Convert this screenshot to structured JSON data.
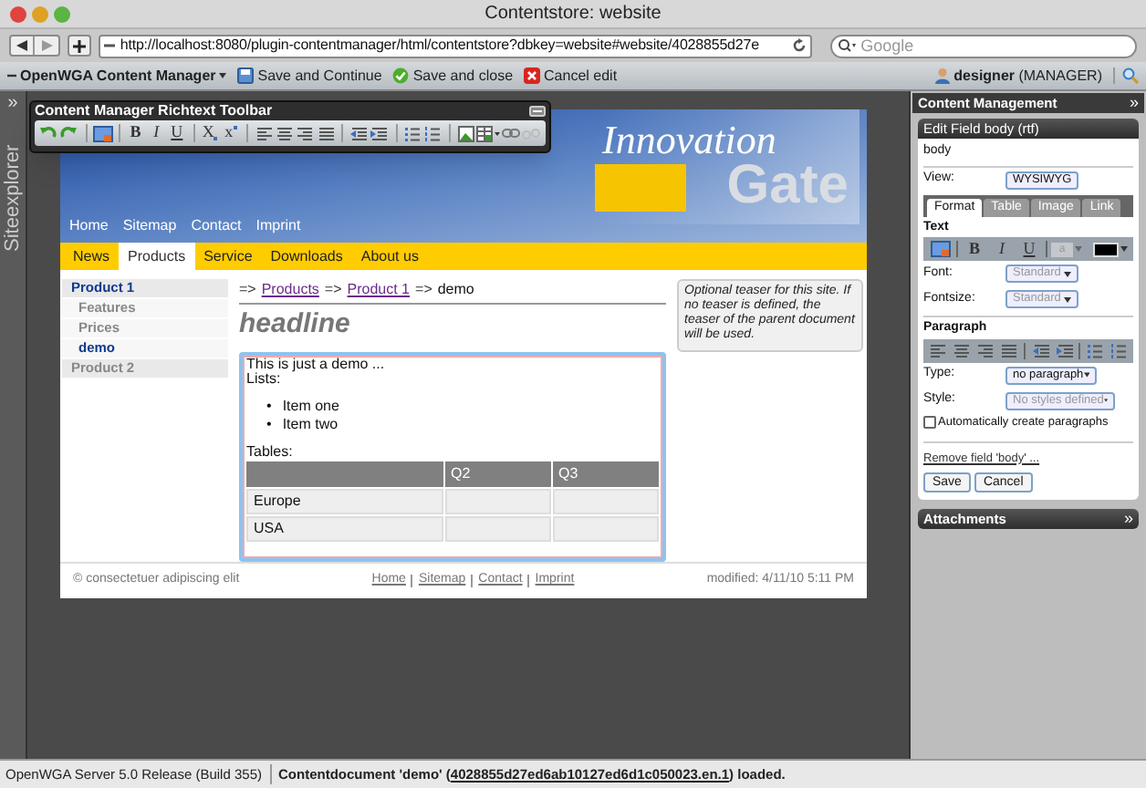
{
  "window": {
    "title": "Contentstore: website"
  },
  "browser_toolbar": {
    "url": "http://localhost:8080/plugin-contentmanager/html/contentstore?dbkey=website#website/4028855d27e",
    "search": {
      "placeholder": "Google"
    }
  },
  "cm_bar": {
    "menu": "OpenWGA Content Manager",
    "actions": [
      {
        "kind": "save",
        "label": "Save and Continue"
      },
      {
        "kind": "confirm",
        "label": "Save and close"
      },
      {
        "kind": "cancel",
        "label": "Cancel edit"
      }
    ],
    "user": "designer",
    "role": "(MANAGER)"
  },
  "siteexplorer": {
    "expand": "»",
    "label": "Siteexplorer"
  },
  "richtext_toolbar": {
    "title": "Content Manager Richtext Toolbar",
    "groups": [
      [
        {
          "kind": "undo"
        },
        {
          "kind": "redo"
        }
      ],
      [
        {
          "kind": "image"
        }
      ],
      [
        {
          "kind": "bold",
          "label": "B"
        },
        {
          "kind": "italic",
          "label": "I"
        },
        {
          "kind": "underline",
          "label": "U"
        }
      ],
      [
        {
          "kind": "subscript",
          "label": "X"
        },
        {
          "kind": "superscript",
          "label": "x"
        }
      ],
      [
        {
          "kind": "align-left"
        },
        {
          "kind": "align-center"
        },
        {
          "kind": "align-right"
        },
        {
          "kind": "justify"
        }
      ],
      [
        {
          "kind": "outdent"
        },
        {
          "kind": "indent"
        }
      ],
      [
        {
          "kind": "bullets"
        },
        {
          "kind": "numbers"
        }
      ],
      [
        {
          "kind": "picture"
        },
        {
          "kind": "table"
        },
        {
          "kind": "link"
        },
        {
          "kind": "unlink"
        }
      ]
    ]
  },
  "site": {
    "logo": {
      "line1": "Innovation",
      "line2": "Gate"
    },
    "top_links": [
      "Home",
      "Sitemap",
      "Contact",
      "Imprint"
    ],
    "nav": [
      {
        "label": "News",
        "selected": false
      },
      {
        "label": "Products",
        "selected": true
      },
      {
        "label": "Service",
        "selected": false
      },
      {
        "label": "Downloads",
        "selected": false
      },
      {
        "label": "About us",
        "selected": false
      }
    ],
    "sidenav": [
      {
        "label": "Product 1",
        "expanded": true,
        "children": [
          {
            "label": "Features",
            "selected": false
          },
          {
            "label": "Prices",
            "selected": false
          },
          {
            "label": "demo",
            "selected": true
          }
        ]
      },
      {
        "label": "Product 2",
        "expanded": false
      }
    ],
    "breadcrumb": [
      {
        "kind": "sep",
        "text": "=>"
      },
      {
        "kind": "link",
        "text": "Products"
      },
      {
        "kind": "sep",
        "text": "=>"
      },
      {
        "kind": "link",
        "text": "Product 1"
      },
      {
        "kind": "sep",
        "text": "=>"
      },
      {
        "kind": "current",
        "text": "demo"
      }
    ],
    "headline": "headline",
    "editor": {
      "intro": "This is just a demo ...",
      "lists_label": "Lists:",
      "list_items": [
        {
          "marker": "•",
          "text": "Item one"
        },
        {
          "marker": "•",
          "text": "Item two"
        }
      ],
      "tables_label": "Tables:",
      "columns": [
        "Q2",
        "Q3"
      ],
      "rows": [
        {
          "label": "Europe"
        },
        {
          "label": "USA"
        }
      ]
    },
    "teaser": "Optional teaser for this site. If no teaser is defined, the teaser of the parent document will be used.",
    "footer": {
      "copyright": "© consectetuer adipiscing elit",
      "links": [
        "Home",
        "Sitemap",
        "Contact",
        "Imprint"
      ],
      "modified": "modified: 4/11/10 5:11 PM"
    }
  },
  "panel": {
    "title": "Content Management",
    "collapse": "»",
    "editor": {
      "title": "Edit Field body (rtf)",
      "field": "body",
      "view_label": "View:",
      "view": "WYSIWYG",
      "tabs": [
        {
          "label": "Format",
          "selected": true
        },
        {
          "label": "Table",
          "selected": false
        },
        {
          "label": "Image",
          "selected": false
        },
        {
          "label": "Link",
          "selected": false
        }
      ],
      "text_heading": "Text",
      "text_tools": [
        "B",
        "I",
        "U"
      ],
      "color_sample": "a",
      "font_label": "Font:",
      "font": "Standard",
      "fontsize_label": "Fontsize:",
      "fontsize": "Standard",
      "paragraph_heading": "Paragraph",
      "type_label": "Type:",
      "type": "no paragraph",
      "style_label": "Style:",
      "style": "No styles defined",
      "auto_paragraphs": {
        "label": "Automatically create paragraphs",
        "checked": false
      },
      "remove_link": "Remove field 'body' ...",
      "buttons": [
        "Save",
        "Cancel"
      ]
    },
    "attachments": {
      "title": "Attachments",
      "expand": "»"
    }
  },
  "status_bar": {
    "server": "OpenWGA Server 5.0 Release (Build 355)",
    "message_start": "Contentdocument 'demo' (",
    "link": "4028855d27ed6ab10127ed6d1c050023.en.1",
    "message_end": ") loaded."
  }
}
